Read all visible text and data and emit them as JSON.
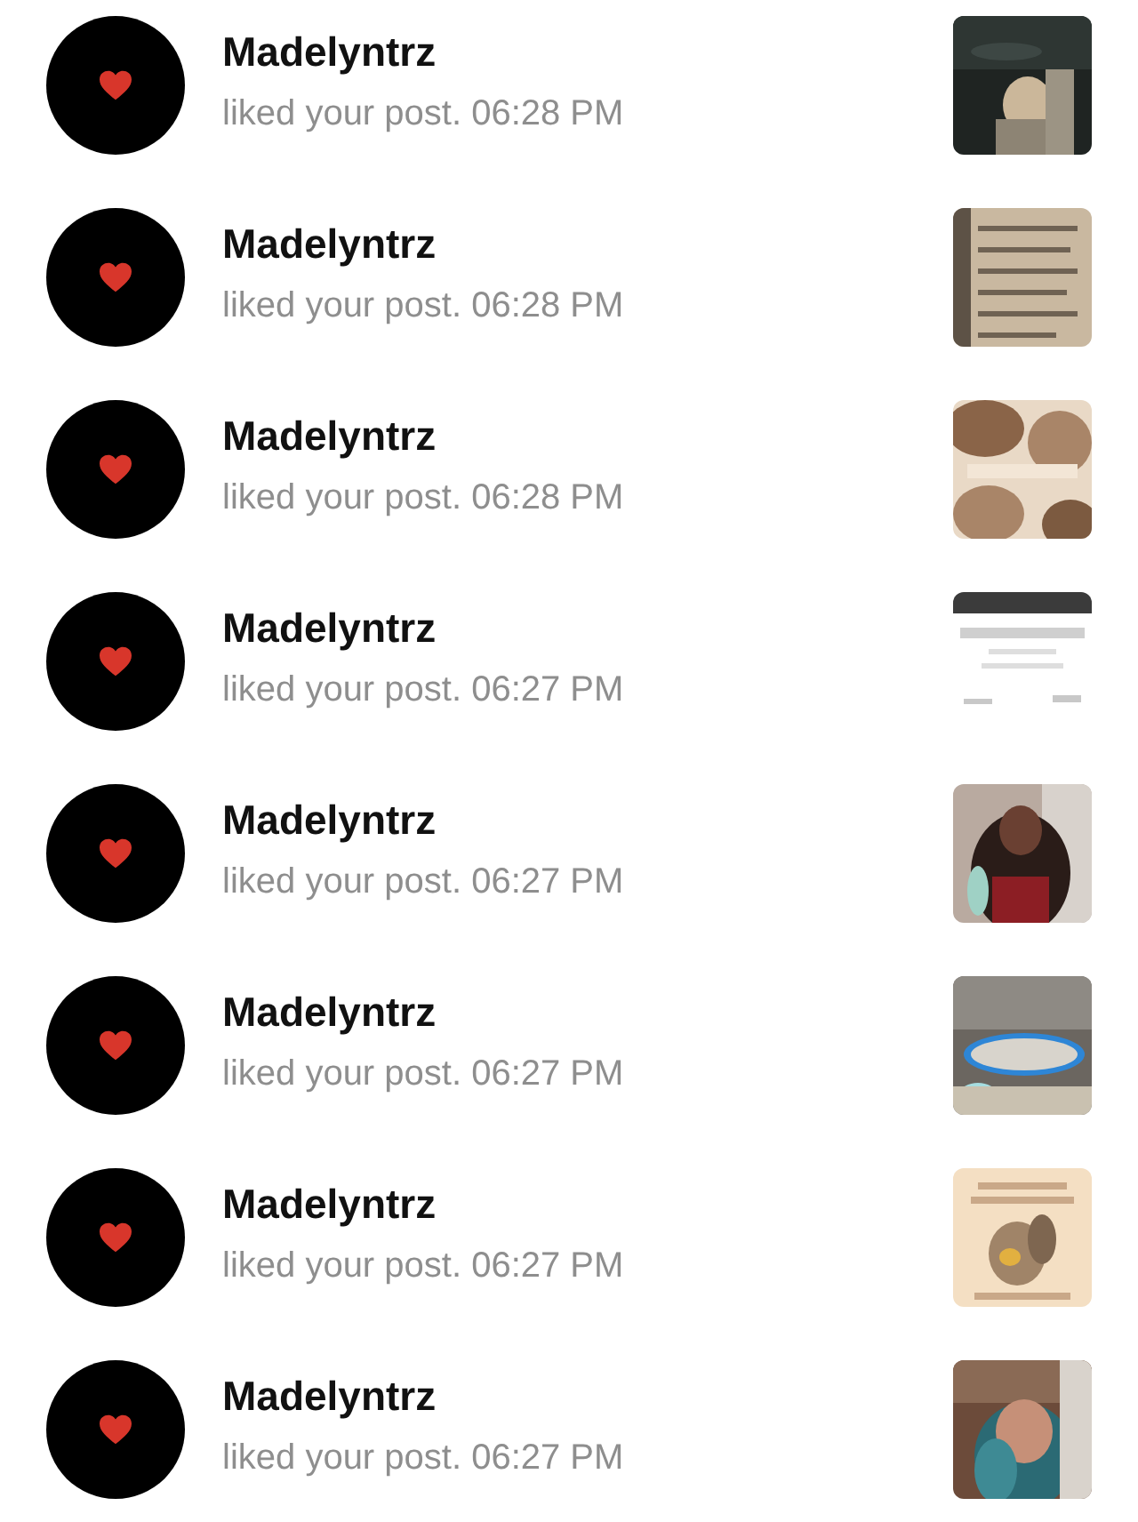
{
  "notifications": [
    {
      "name": "Madelyntrz",
      "text": "liked your post. 06:28 PM"
    },
    {
      "name": "Madelyntrz",
      "text": "liked your post. 06:28 PM"
    },
    {
      "name": "Madelyntrz",
      "text": "liked your post. 06:28 PM"
    },
    {
      "name": "Madelyntrz",
      "text": "liked your post. 06:27 PM"
    },
    {
      "name": "Madelyntrz",
      "text": "liked your post. 06:27 PM"
    },
    {
      "name": "Madelyntrz",
      "text": "liked your post. 06:27 PM"
    },
    {
      "name": "Madelyntrz",
      "text": "liked your post. 06:27 PM"
    },
    {
      "name": "Madelyntrz",
      "text": "liked your post. 06:27 PM"
    }
  ]
}
